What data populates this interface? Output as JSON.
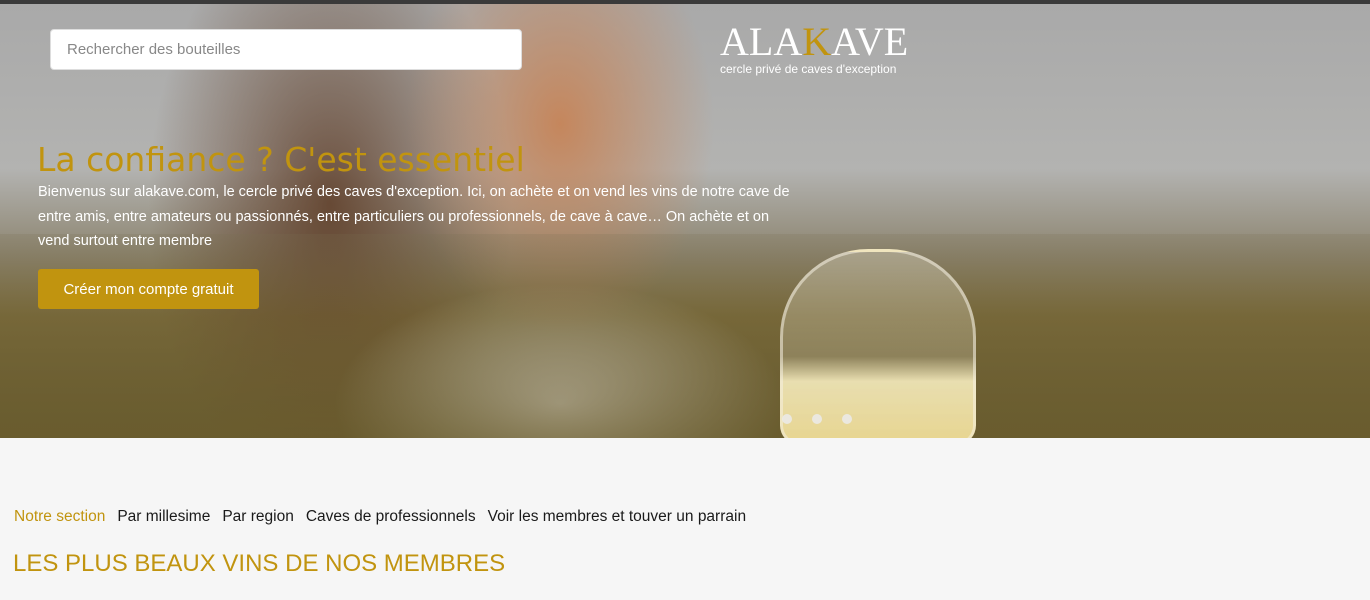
{
  "search": {
    "placeholder": "Rechercher des bouteilles"
  },
  "logo": {
    "word_start": "ALA",
    "word_accent": "K",
    "word_end": "AVE",
    "tagline": "cercle privé de caves d'exception"
  },
  "hero": {
    "title": "La confiance ? C'est essentiel",
    "text": "Bienvenus sur alakave.com, le cercle privé des caves d'exception. Ici, on achète et on vend les vins de notre cave de entre amis, entre amateurs ou passionnés, entre particuliers ou professionnels, de cave à cave… On achète et on vend surtout entre membre",
    "cta_label": "Créer mon compte gratuit"
  },
  "carousel": {
    "slide_count": 3
  },
  "nav": {
    "items": [
      {
        "label": "Notre section",
        "active": true
      },
      {
        "label": "Par millesime",
        "active": false
      },
      {
        "label": "Par region",
        "active": false
      },
      {
        "label": "Caves de professionnels",
        "active": false
      },
      {
        "label": "Voir les membres et touver un parrain",
        "active": false
      }
    ]
  },
  "section": {
    "title": "LES PLUS BEAUX VINS DE NOS MEMBRES"
  },
  "colors": {
    "accent": "#c1940f",
    "background": "#f6f6f6",
    "text": "#1a1a1a"
  }
}
